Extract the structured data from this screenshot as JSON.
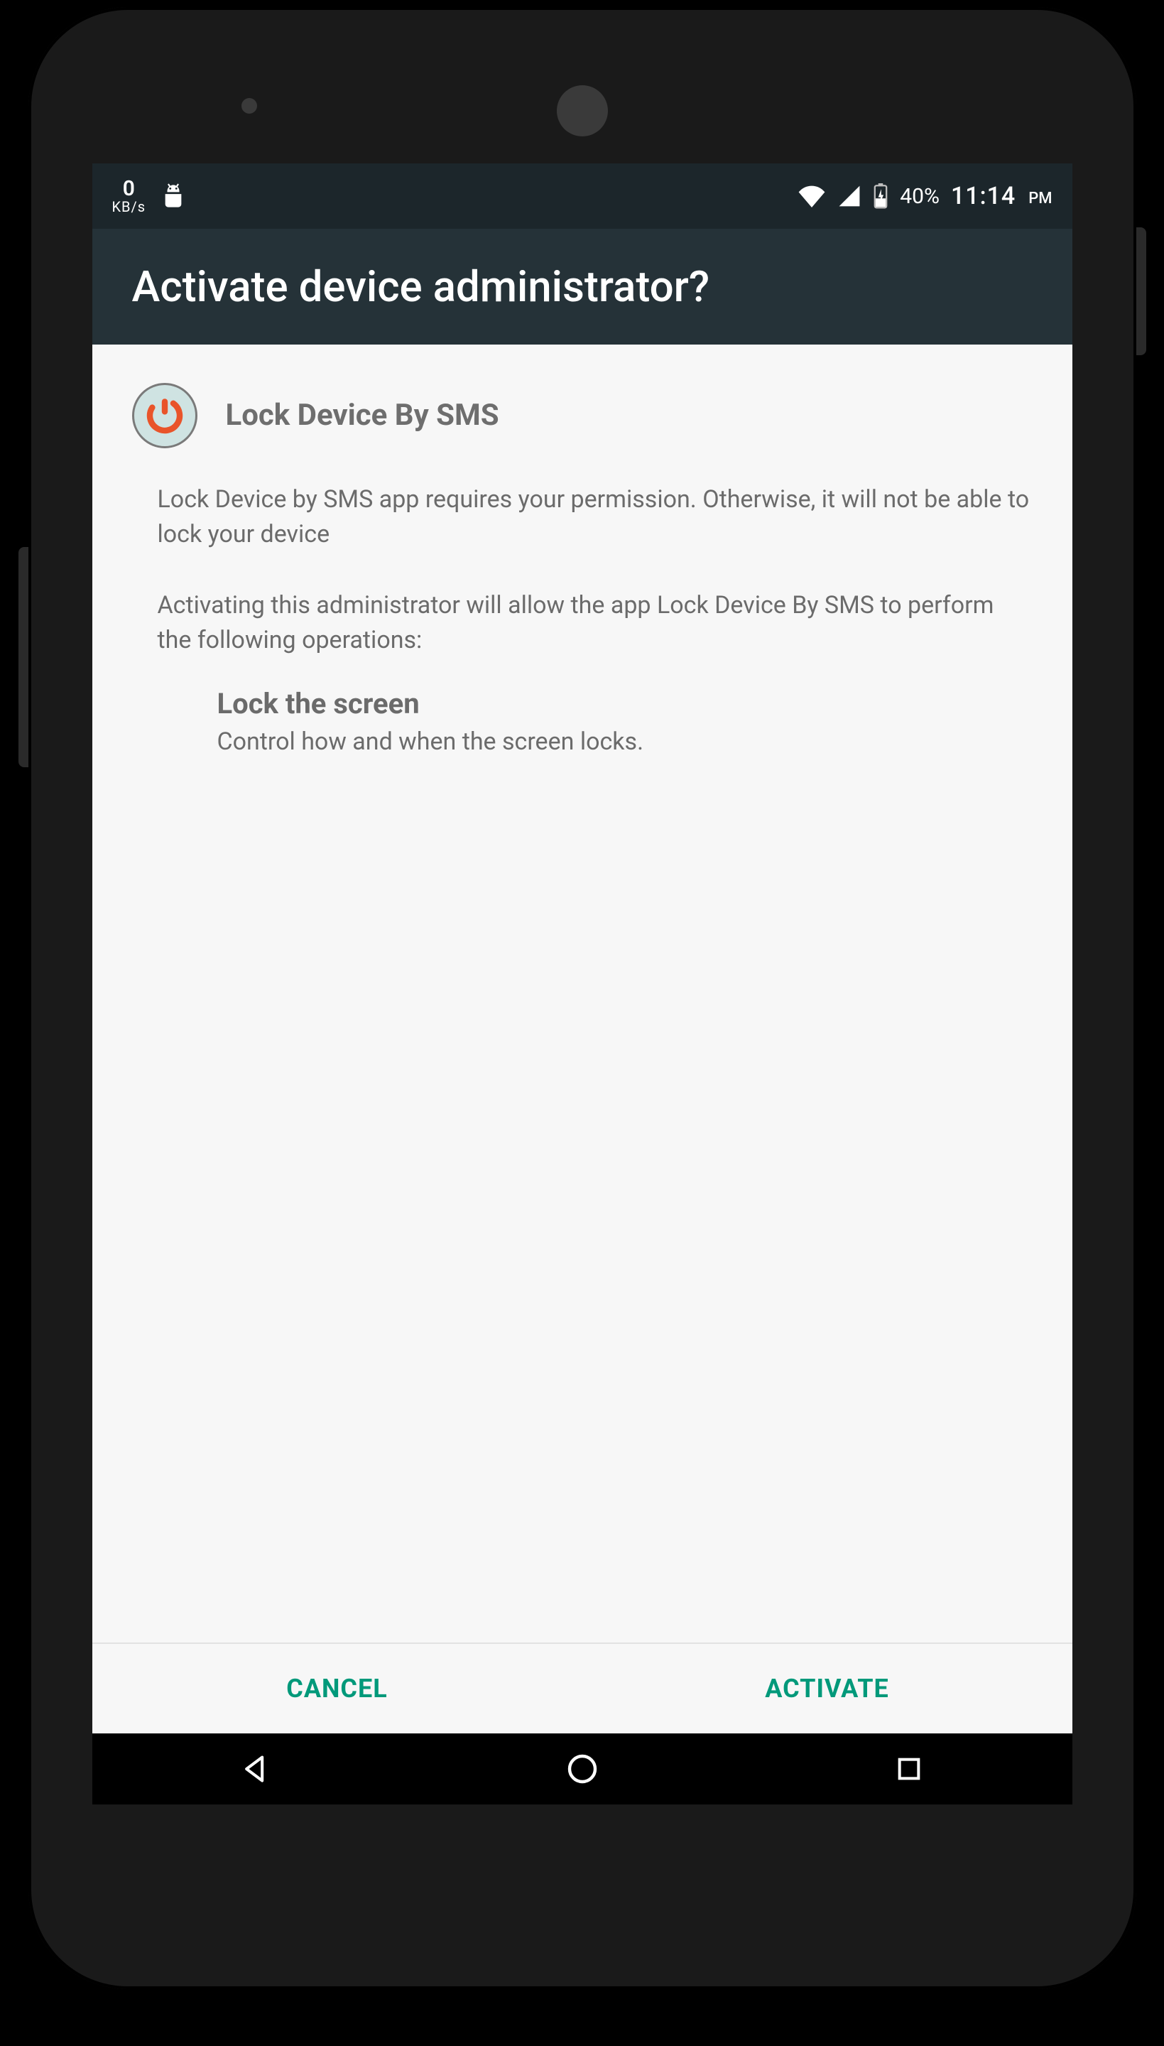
{
  "statusbar": {
    "net_speed_value": "0",
    "net_speed_unit": "KB/s",
    "battery_pct": "40%",
    "time": "11:14",
    "ampm": "PM"
  },
  "appbar": {
    "title": "Activate device administrator?"
  },
  "content": {
    "app_name": "Lock Device By SMS",
    "permission_desc": "Lock Device by SMS app requires your permission. Otherwise, it will not be able to lock your device",
    "permission_intro": "Activating this administrator will allow the app Lock Device By SMS to perform the following operations:",
    "perm_item_title": "Lock the screen",
    "perm_item_sub": "Control how and when the screen locks."
  },
  "buttons": {
    "cancel": "CANCEL",
    "activate": "ACTIVATE"
  }
}
